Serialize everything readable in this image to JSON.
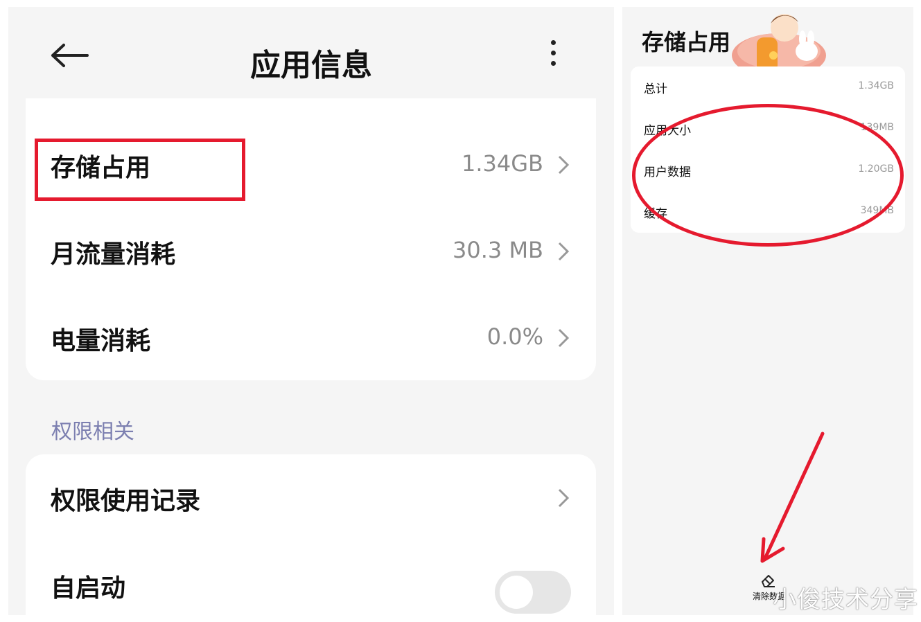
{
  "left": {
    "header": {
      "title": "应用信息"
    },
    "usage_rows": [
      {
        "label": "存储占用",
        "value": "1.34GB"
      },
      {
        "label": "月流量消耗",
        "value": "30.3 MB"
      },
      {
        "label": "电量消耗",
        "value": "0.0%"
      }
    ],
    "permissions": {
      "section_title": "权限相关",
      "rows": [
        {
          "label": "权限使用记录"
        },
        {
          "label": "自启动",
          "toggle_on": false
        }
      ]
    }
  },
  "right": {
    "title": "存储占用",
    "rows": [
      {
        "label": "总计",
        "value": "1.34GB"
      },
      {
        "label": "应用大小",
        "value": "139MB"
      },
      {
        "label": "用户数据",
        "value": "1.20GB"
      },
      {
        "label": "缓存",
        "value": "349MB"
      }
    ],
    "clear_data_label": "清除数据"
  },
  "watermark": "小俊技术分享",
  "colors": {
    "highlight": "#e51a2e",
    "section_header": "#7c7fb0",
    "background": "#f5f5f5"
  },
  "icons": {
    "back": "back-arrow-icon",
    "more": "more-vertical-icon",
    "chevron": "chevron-right-icon",
    "eraser": "eraser-icon"
  }
}
